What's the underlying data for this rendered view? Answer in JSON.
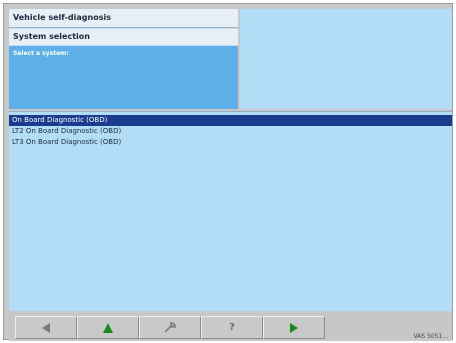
{
  "header": {
    "title": "Vehicle self-diagnosis",
    "subtitle": "System selection",
    "prompt": "Select a system:"
  },
  "systems": [
    {
      "label": "On Board Diagnostic (OBD)",
      "selected": true
    },
    {
      "label": "LT2 On Board Diagnostic (OBD)",
      "selected": false
    },
    {
      "label": "LT3 On Board Diagnostic (OBD)",
      "selected": false
    }
  ],
  "toolbar": {
    "help_glyph": "?",
    "status": "VAS 5051..."
  },
  "colors": {
    "selection": "#1b3b8f",
    "list_bg": "#b3dcf6",
    "prompt_bg": "#5fb0ea",
    "arrow_green": "#1a8a1a"
  },
  "icons": [
    "back-arrow-icon",
    "up-arrow-icon",
    "tool-icon",
    "help-icon",
    "forward-arrow-icon"
  ]
}
